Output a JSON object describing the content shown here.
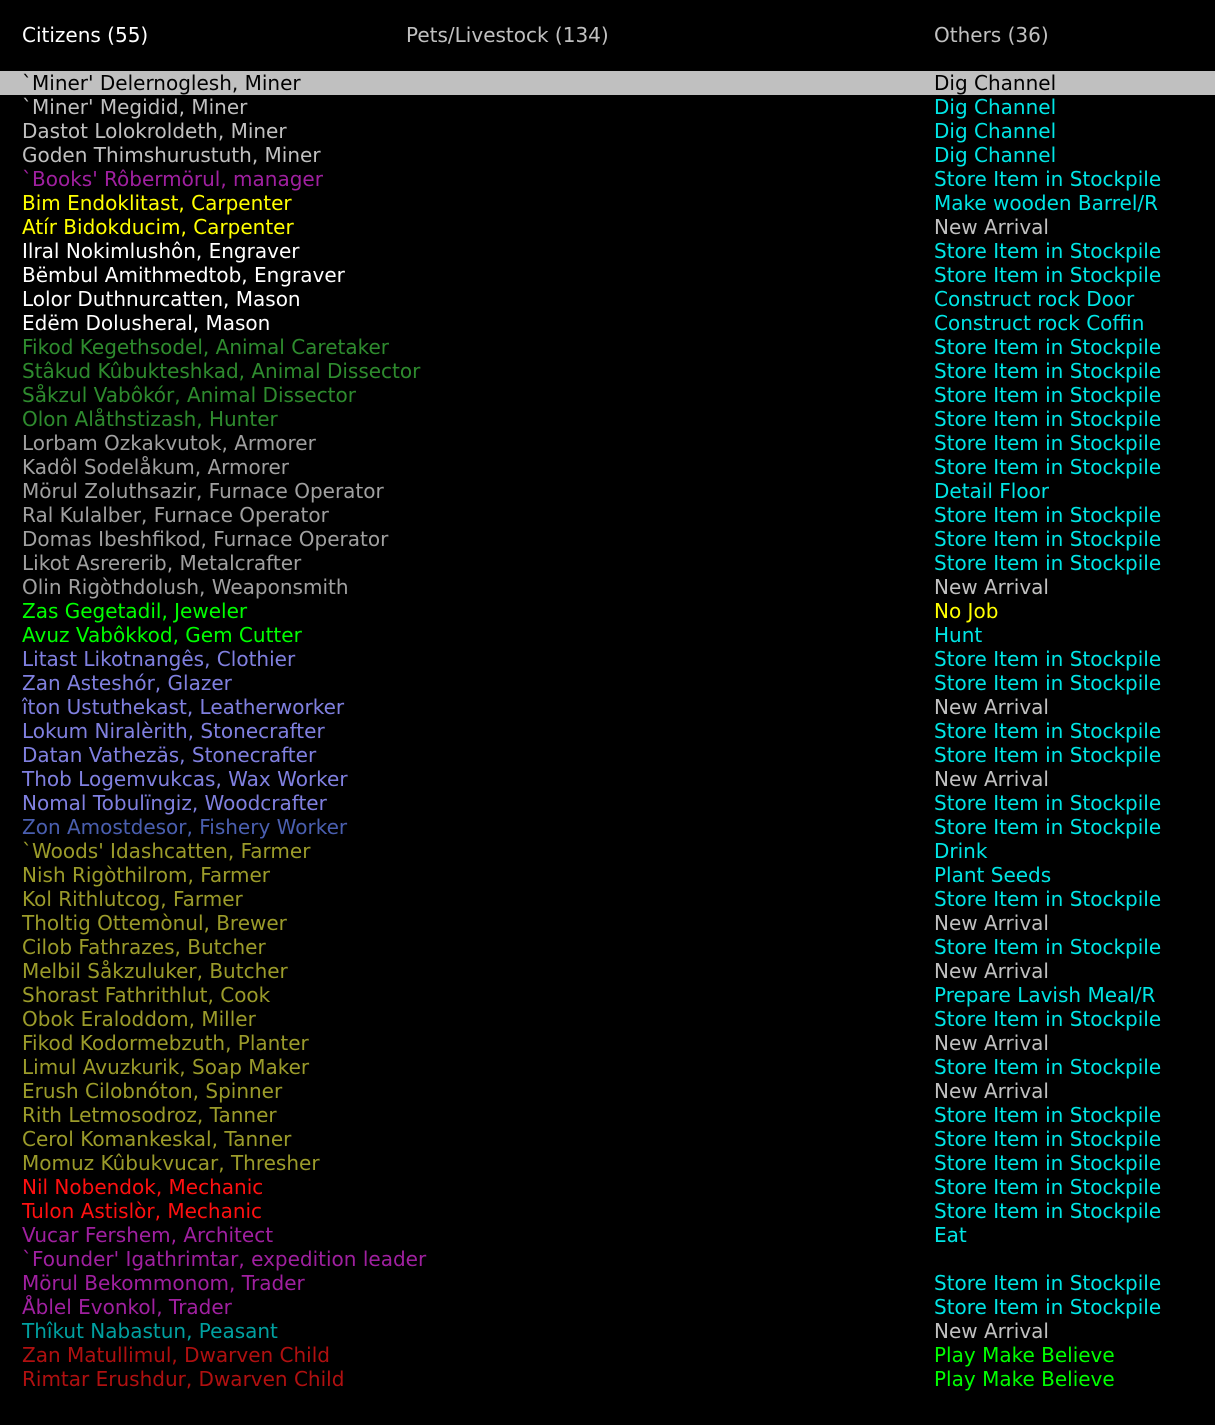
{
  "tabs": {
    "citizens": "Citizens (55)",
    "pets": "Pets/Livestock (134)",
    "others": "Others (36)"
  },
  "colors": {
    "white": "#ffffff",
    "lightgray": "#c0c0c0",
    "gray": "#a0a0a0",
    "yellow": "#ffff00",
    "cyan": "#00e5e5",
    "green": "#00ff00",
    "darkgreen": "#2e8b2e",
    "magenta": "#a020a0",
    "blue": "#8080e0",
    "darkblue": "#4a5fb0",
    "olive": "#9b9b2a",
    "red": "#ff1010",
    "darkred": "#b01010",
    "teal": "#00a0a0",
    "selected_bg": "#c0c0c0"
  },
  "citizens": [
    {
      "name": "`Miner' Delernoglesh, Miner",
      "job": "Dig Channel",
      "name_color": "lightgray",
      "job_color": "lightgray",
      "selected": true
    },
    {
      "name": "`Miner' Megidid, Miner",
      "job": "Dig Channel",
      "name_color": "lightgray",
      "job_color": "cyan"
    },
    {
      "name": "Dastot Lolokroldeth, Miner",
      "job": "Dig Channel",
      "name_color": "lightgray",
      "job_color": "cyan"
    },
    {
      "name": "Goden Thimshurustuth, Miner",
      "job": "Dig Channel",
      "name_color": "lightgray",
      "job_color": "cyan"
    },
    {
      "name": "`Books' Rôbermörul, manager",
      "job": "Store Item in Stockpile",
      "name_color": "magenta",
      "job_color": "cyan"
    },
    {
      "name": "Bim Endoklitast, Carpenter",
      "job": "Make wooden Barrel/R",
      "name_color": "yellow",
      "job_color": "cyan"
    },
    {
      "name": "Atír Bidokducim, Carpenter",
      "job": "New Arrival",
      "name_color": "yellow",
      "job_color": "lightgray"
    },
    {
      "name": "Ilral Nokimlushôn, Engraver",
      "job": "Store Item in Stockpile",
      "name_color": "white",
      "job_color": "cyan"
    },
    {
      "name": "Bëmbul Amithmedtob, Engraver",
      "job": "Store Item in Stockpile",
      "name_color": "white",
      "job_color": "cyan"
    },
    {
      "name": "Lolor Duthnurcatten, Mason",
      "job": "Construct rock Door",
      "name_color": "white",
      "job_color": "cyan"
    },
    {
      "name": "Edëm Dolusheral, Mason",
      "job": "Construct rock Coffin",
      "name_color": "white",
      "job_color": "cyan"
    },
    {
      "name": "Fikod Kegethsodel, Animal Caretaker",
      "job": "Store Item in Stockpile",
      "name_color": "darkgreen",
      "job_color": "cyan"
    },
    {
      "name": "Stâkud Kûbukteshkad, Animal Dissector",
      "job": "Store Item in Stockpile",
      "name_color": "darkgreen",
      "job_color": "cyan"
    },
    {
      "name": "Såkzul Vabôkór, Animal Dissector",
      "job": "Store Item in Stockpile",
      "name_color": "darkgreen",
      "job_color": "cyan"
    },
    {
      "name": "Olon Alåthstizash, Hunter",
      "job": "Store Item in Stockpile",
      "name_color": "darkgreen",
      "job_color": "cyan"
    },
    {
      "name": "Lorbam Ozkakvutok, Armorer",
      "job": "Store Item in Stockpile",
      "name_color": "gray",
      "job_color": "cyan"
    },
    {
      "name": "Kadôl Sodelåkum, Armorer",
      "job": "Store Item in Stockpile",
      "name_color": "gray",
      "job_color": "cyan"
    },
    {
      "name": "Mörul Zoluthsazir, Furnace Operator",
      "job": "Detail Floor",
      "name_color": "gray",
      "job_color": "cyan"
    },
    {
      "name": "Ral Kulalber, Furnace Operator",
      "job": "Store Item in Stockpile",
      "name_color": "gray",
      "job_color": "cyan"
    },
    {
      "name": "Domas Ibeshfikod, Furnace Operator",
      "job": "Store Item in Stockpile",
      "name_color": "gray",
      "job_color": "cyan"
    },
    {
      "name": "Likot Asrererib, Metalcrafter",
      "job": "Store Item in Stockpile",
      "name_color": "gray",
      "job_color": "cyan"
    },
    {
      "name": "Olin Rigòthdolush, Weaponsmith",
      "job": "New Arrival",
      "name_color": "gray",
      "job_color": "lightgray"
    },
    {
      "name": "Zas Gegetadil, Jeweler",
      "job": "No Job",
      "name_color": "green",
      "job_color": "yellow"
    },
    {
      "name": "Avuz Vabôkkod, Gem Cutter",
      "job": "Hunt",
      "name_color": "green",
      "job_color": "cyan"
    },
    {
      "name": "Litast Likotnangês, Clothier",
      "job": "Store Item in Stockpile",
      "name_color": "blue",
      "job_color": "cyan"
    },
    {
      "name": "Zan Asteshór, Glazer",
      "job": "Store Item in Stockpile",
      "name_color": "blue",
      "job_color": "cyan"
    },
    {
      "name": "îton Ustuthekast, Leatherworker",
      "job": "New Arrival",
      "name_color": "blue",
      "job_color": "lightgray"
    },
    {
      "name": "Lokum Niralèrith, Stonecrafter",
      "job": "Store Item in Stockpile",
      "name_color": "blue",
      "job_color": "cyan"
    },
    {
      "name": "Datan Vathezäs, Stonecrafter",
      "job": "Store Item in Stockpile",
      "name_color": "blue",
      "job_color": "cyan"
    },
    {
      "name": "Thob Logemvukcas, Wax Worker",
      "job": "New Arrival",
      "name_color": "blue",
      "job_color": "lightgray"
    },
    {
      "name": "Nomal Tobulïngiz, Woodcrafter",
      "job": "Store Item in Stockpile",
      "name_color": "blue",
      "job_color": "cyan"
    },
    {
      "name": "Zon Amostdesor, Fishery Worker",
      "job": "Store Item in Stockpile",
      "name_color": "darkblue",
      "job_color": "cyan"
    },
    {
      "name": "`Woods' Idashcatten, Farmer",
      "job": "Drink",
      "name_color": "olive",
      "job_color": "cyan"
    },
    {
      "name": "Nish Rigòthilrom, Farmer",
      "job": "Plant Seeds",
      "name_color": "olive",
      "job_color": "cyan"
    },
    {
      "name": "Kol Rithlutcog, Farmer",
      "job": "Store Item in Stockpile",
      "name_color": "olive",
      "job_color": "cyan"
    },
    {
      "name": "Tholtig Ottemònul, Brewer",
      "job": "New Arrival",
      "name_color": "olive",
      "job_color": "lightgray"
    },
    {
      "name": "Cilob Fathrazes, Butcher",
      "job": "Store Item in Stockpile",
      "name_color": "olive",
      "job_color": "cyan"
    },
    {
      "name": "Melbil Såkzuluker, Butcher",
      "job": "New Arrival",
      "name_color": "olive",
      "job_color": "lightgray"
    },
    {
      "name": "Shorast Fathrithlut, Cook",
      "job": "Prepare Lavish Meal/R",
      "name_color": "olive",
      "job_color": "cyan"
    },
    {
      "name": "Obok Eraloddom, Miller",
      "job": "Store Item in Stockpile",
      "name_color": "olive",
      "job_color": "cyan"
    },
    {
      "name": "Fikod Kodormebzuth, Planter",
      "job": "New Arrival",
      "name_color": "olive",
      "job_color": "lightgray"
    },
    {
      "name": "Limul Avuzkurik, Soap Maker",
      "job": "Store Item in Stockpile",
      "name_color": "olive",
      "job_color": "cyan"
    },
    {
      "name": "Erush Cilobnóton, Spinner",
      "job": "New Arrival",
      "name_color": "olive",
      "job_color": "lightgray"
    },
    {
      "name": "Rith Letmosodroz, Tanner",
      "job": "Store Item in Stockpile",
      "name_color": "olive",
      "job_color": "cyan"
    },
    {
      "name": "Cerol Komankeskal, Tanner",
      "job": "Store Item in Stockpile",
      "name_color": "olive",
      "job_color": "cyan"
    },
    {
      "name": "Momuz Kûbukvucar, Thresher",
      "job": "Store Item in Stockpile",
      "name_color": "olive",
      "job_color": "cyan"
    },
    {
      "name": "Nil Nobendok, Mechanic",
      "job": "Store Item in Stockpile",
      "name_color": "red",
      "job_color": "cyan"
    },
    {
      "name": "Tulon Astislòr, Mechanic",
      "job": "Store Item in Stockpile",
      "name_color": "red",
      "job_color": "cyan"
    },
    {
      "name": "Vucar Fershem, Architect",
      "job": "Eat",
      "name_color": "magenta",
      "job_color": "cyan"
    },
    {
      "name": "`Founder' Igathrimtar, expedition leader",
      "job": "",
      "name_color": "magenta",
      "job_color": "cyan"
    },
    {
      "name": "Mörul Bekommonom, Trader",
      "job": "Store Item in Stockpile",
      "name_color": "magenta",
      "job_color": "cyan"
    },
    {
      "name": "Åblel Evonkol, Trader",
      "job": "Store Item in Stockpile",
      "name_color": "magenta",
      "job_color": "cyan"
    },
    {
      "name": "Thîkut Nabastun, Peasant",
      "job": "New Arrival",
      "name_color": "teal",
      "job_color": "lightgray"
    },
    {
      "name": "Zan Matullimul, Dwarven Child",
      "job": "Play Make Believe",
      "name_color": "darkred",
      "job_color": "green"
    },
    {
      "name": "Rimtar Erushdur, Dwarven Child",
      "job": "Play Make Believe",
      "name_color": "darkred",
      "job_color": "green"
    }
  ]
}
